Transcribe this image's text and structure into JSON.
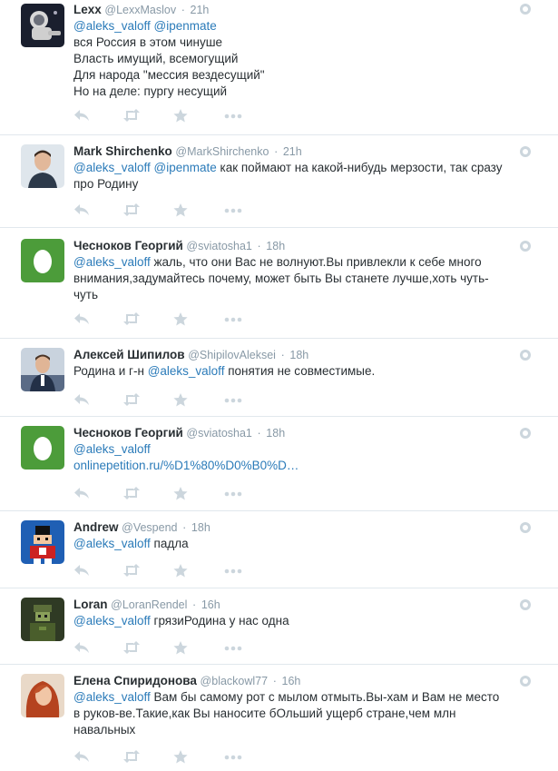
{
  "colors": {
    "link": "#2b7bb9",
    "meta": "#8899a6",
    "text": "#292f33",
    "icon": "#ccd6dd"
  },
  "actions": {
    "reply": "reply-icon",
    "retweet": "retweet-icon",
    "favorite": "favorite-icon",
    "more": "more-icon"
  },
  "tweets": [
    {
      "name": "Lexx",
      "handle": "@LexxMaslov",
      "time": "21h",
      "avatar": "astronaut-photo",
      "mentions": "@aleks_valoff @ipenmate",
      "lines": [
        "вся Россия в этом чинуше",
        "Власть имущий, всемогущий",
        "Для народа \"мессия вездесущий\"",
        "Но на деле: пургу несущий"
      ]
    },
    {
      "name": "Mark Shirchenko",
      "handle": "@MarkShirchenko",
      "time": "21h",
      "avatar": "man-photo",
      "mentions": "@aleks_valoff @ipenmate",
      "inline": " как поймают на какой-нибудь мерзости, так сразу",
      "lines": [
        "про Родину"
      ]
    },
    {
      "name": "Чесноков Георгий",
      "handle": "@sviatosha1",
      "time": "18h",
      "avatar": "default-egg",
      "mentions": "@aleks_valoff",
      "inline": " жаль, что они Вас не волнуют.Вы привлекли к себе много",
      "lines": [
        "внимания,задумайтесь почему, может быть Вы станете лучше,хоть чуть-",
        "чуть"
      ]
    },
    {
      "name": "Алексей Шипилов",
      "handle": "@ShipilovAleksei",
      "time": "18h",
      "avatar": "speaker-photo",
      "prefix": "Родина и г-н ",
      "mentions": "@aleks_valoff",
      "inline": " понятия не совместимые.",
      "lines": []
    },
    {
      "name": "Чесноков Георгий",
      "handle": "@sviatosha1",
      "time": "18h",
      "avatar": "default-egg",
      "mentions": "@aleks_valoff",
      "inline": "",
      "link": "onlinepetition.ru/%D1%80%D0%B0%D…",
      "lines": []
    },
    {
      "name": "Andrew",
      "handle": "@Vespend",
      "time": "18h",
      "avatar": "pixel-art",
      "mentions": "@aleks_valoff",
      "inline": " падла",
      "lines": []
    },
    {
      "name": "Loran",
      "handle": "@LoranRendel",
      "time": "16h",
      "avatar": "soldier-pixel",
      "mentions": "@aleks_valoff",
      "inline": " грязиРодина у нас одна",
      "lines": []
    },
    {
      "name": "Елена Спиридонова",
      "handle": "@blackowl77",
      "time": "16h",
      "avatar": "woman-photo",
      "mentions": "@aleks_valoff",
      "inline": " Вам бы самому рот с мылом отмыть.Вы-хам и Вам не место",
      "lines": [
        "в руков-ве.Такие,как Вы наносите бОльший ущерб стране,чем млн",
        "навальных"
      ]
    }
  ]
}
